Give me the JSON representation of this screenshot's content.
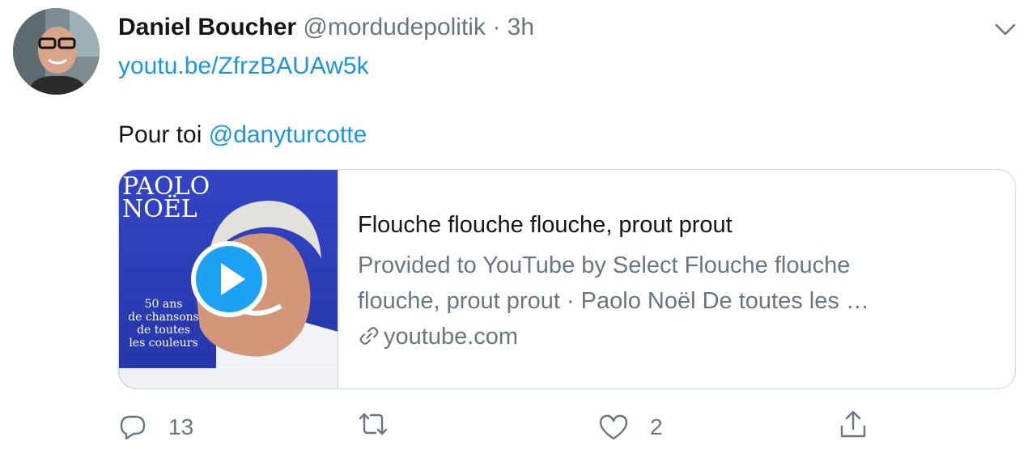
{
  "tweet": {
    "author_name": "Daniel Boucher",
    "handle": "@mordudepolitik",
    "separator": "·",
    "time": "3h",
    "link": "youtu.be/ZfrzBAUAw5k",
    "text_prefix": "Pour toi",
    "mention": "@danyturcotte"
  },
  "card": {
    "album_artist": "PAOLO NOËL",
    "album_artist_line1": "PAOLO",
    "album_artist_line2": "NOËL",
    "album_caption": [
      "50 ans",
      "de chansons",
      "de toutes",
      "les couleurs"
    ],
    "title": "Flouche flouche flouche, prout prout",
    "description_line1": "Provided to YouTube by Select Flouche flouche",
    "description_line2": "flouche, prout prout · Paolo Noël De toutes les …",
    "domain": "youtube.com"
  },
  "actions": {
    "reply_count": "13",
    "retweet_count": "",
    "like_count": "2"
  },
  "icons": {
    "reply": "reply-icon",
    "retweet": "retweet-icon",
    "like": "heart-icon",
    "share": "share-icon",
    "more": "chevron-down-icon",
    "link": "link-icon",
    "play": "play-icon"
  },
  "colors": {
    "link_blue": "#1b95e0",
    "secondary_text": "#657786",
    "primary_text": "#14171a",
    "border": "#ccd6dd",
    "play_blue": "#1da1f2",
    "album_blue": "#2a3fb8"
  }
}
